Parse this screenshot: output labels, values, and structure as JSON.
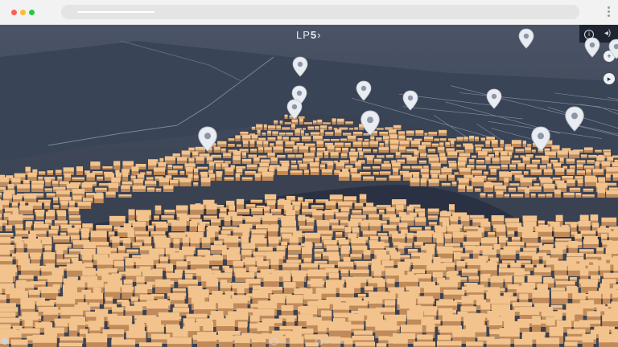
{
  "browser": {
    "controls": [
      "close",
      "minimize",
      "maximize"
    ],
    "menu_icon": "kebab-menu-icon"
  },
  "app": {
    "logo_text": "LP",
    "logo_number": "5",
    "logo_suffix": "›"
  },
  "controls": {
    "info_icon": "info-icon",
    "info_glyph": "i",
    "sound_icon": "sound-icon",
    "sound_glyph": "◂)",
    "side_buttons": [
      {
        "icon": "add-icon",
        "glyph": "+"
      },
      {
        "icon": "play-icon",
        "glyph": "▸"
      }
    ]
  },
  "map": {
    "pin_icon": "map-pin-icon",
    "pin_count": 13,
    "colors": {
      "sky": "#3b4455",
      "water": "#2f3748",
      "buildings": "#efbe88",
      "shadow": "#a07450",
      "roads": "#cfd8e6"
    }
  },
  "bottom": {
    "left_control_icon": "back-arrow-icon",
    "items": [
      {
        "icon": "location-icon",
        "label": "........"
      },
      {
        "icon": "compass-icon",
        "label": "All Places"
      }
    ]
  }
}
